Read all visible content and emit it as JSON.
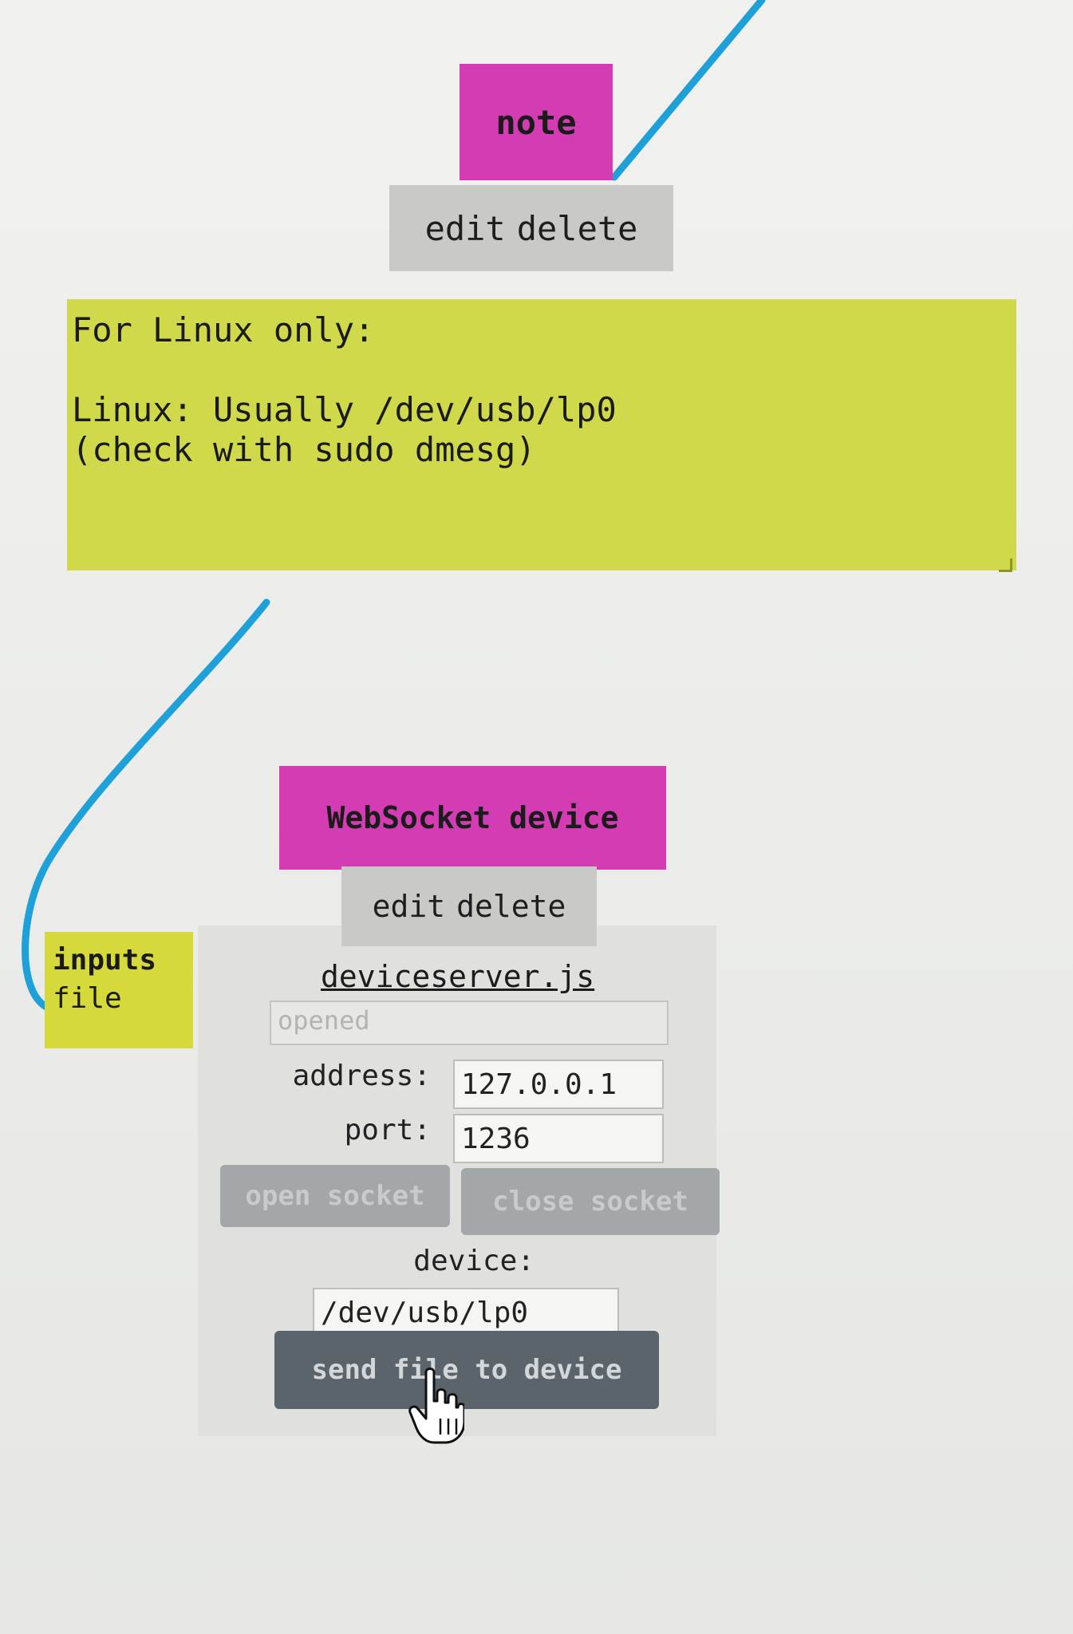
{
  "note_node": {
    "title": "note",
    "menu": {
      "edit": "edit",
      "delete": "delete"
    },
    "text": "For Linux only:\n\nLinux: Usually /dev/usb/lp0\n(check with sudo dmesg)"
  },
  "ws_node": {
    "title": "WebSocket device",
    "menu": {
      "edit": "edit",
      "delete": "delete"
    },
    "port_label": {
      "line1": "inputs",
      "line2": "file"
    },
    "link": "deviceserver.js",
    "status": "opened",
    "address_label": "address:",
    "address_value": "127.0.0.1",
    "port_label_text": "port:",
    "port_value": "1236",
    "open_socket": "open socket",
    "close_socket": "close socket",
    "device_label": "device:",
    "device_value": "/dev/usb/lp0",
    "send_button": "send file to device"
  },
  "colors": {
    "node_header": "#d43cb4",
    "note_body": "#cfd94a",
    "port_label": "#d6d93a",
    "wire": "#1ea0d8",
    "button_primary": "#5a646a",
    "button_disabled": "#a4a7a9"
  },
  "icons": {
    "cursor": "hand-pointer-icon",
    "resize": "resize-handle-icon"
  }
}
